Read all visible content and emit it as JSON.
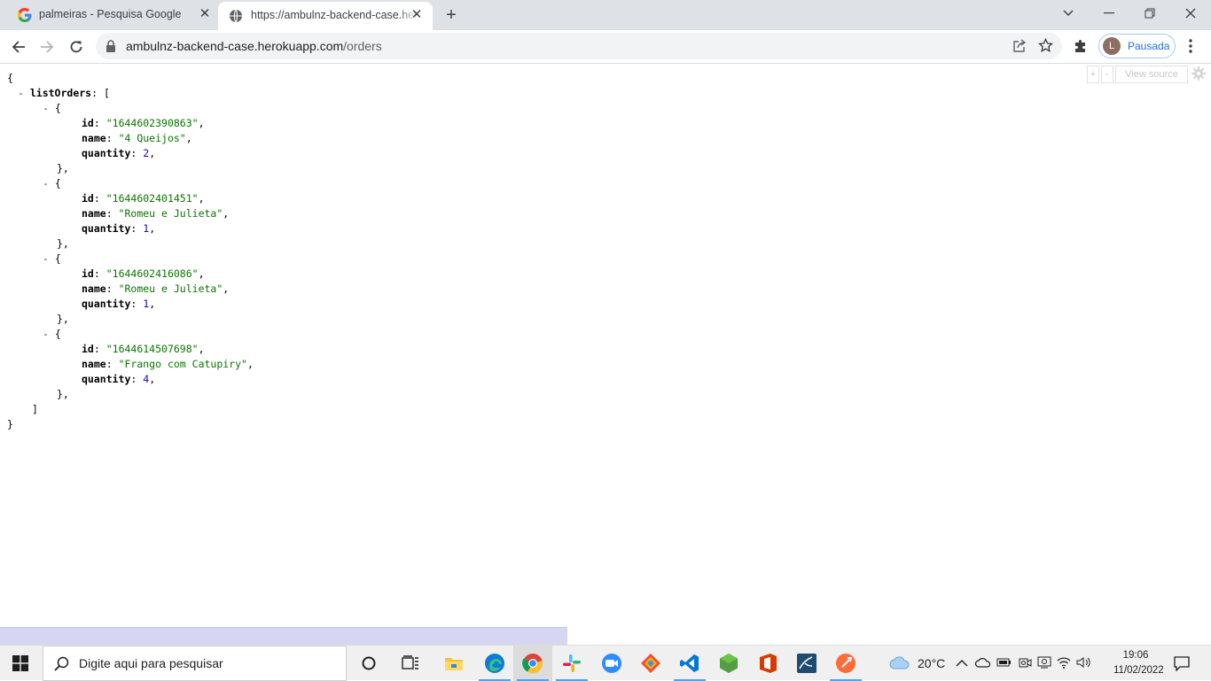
{
  "browser": {
    "tabs": [
      {
        "title": "palmeiras - Pesquisa Google",
        "icon": "google-g-icon"
      },
      {
        "title": "https://ambulnz-backend-case.herokuapp.com/orders",
        "icon": "globe-icon"
      }
    ],
    "address": {
      "host": "ambulnz-backend-case.herokuapp.com",
      "path": "/orders"
    },
    "profile": {
      "initial": "L",
      "status": "Pausada"
    }
  },
  "json_viewer": {
    "root_key": "listOrders",
    "orders": [
      {
        "id": "\"1644602390863\"",
        "name": "\"4 Queijos\"",
        "quantity": "2"
      },
      {
        "id": "\"1644602401451\"",
        "name": "\"Romeu e Julieta\"",
        "quantity": "1"
      },
      {
        "id": "\"1644602416086\"",
        "name": "\"Romeu e Julieta\"",
        "quantity": "1"
      },
      {
        "id": "\"1644614507698\"",
        "name": "\"Frango com Catupiry\"",
        "quantity": "4"
      }
    ],
    "toolbar": {
      "expand": "+",
      "collapse": "-",
      "view_source": "View source"
    }
  },
  "taskbar": {
    "search_placeholder": "Digite aqui para pesquisar",
    "weather": "20°C",
    "time": "19:06",
    "date": "11/02/2022"
  }
}
